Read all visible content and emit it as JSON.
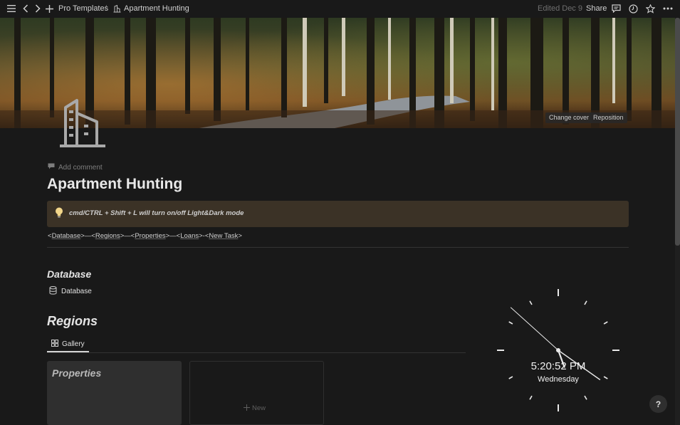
{
  "topbar": {
    "breadcrumb_parent": "Pro Templates",
    "breadcrumb_sep": "/",
    "breadcrumb_current": "Apartment Hunting",
    "edited": "Edited Dec 9",
    "share": "Share"
  },
  "cover": {
    "change_cover": "Change cover",
    "reposition": "Reposition"
  },
  "page": {
    "add_comment": "Add comment",
    "title": "Apartment Hunting",
    "callout_text": "cmd/CTRL + Shift + L will turn on/off Light&Dark mode",
    "nav": {
      "p1": "<",
      "database": "Database",
      "p2": ">—<",
      "regions": "Regions",
      "p3": ">—<",
      "properties": "Properties",
      "p4": ">—<",
      "loans": "Loans",
      "p5": ">-<",
      "new_task": "New Task",
      "p6": ">"
    },
    "database_heading": "Database",
    "database_link": "Database",
    "regions_heading": "Regions",
    "gallery_tab": "Gallery",
    "card_title": "Properties",
    "new_label": "New"
  },
  "clock": {
    "time": "5:20:52 PM",
    "day": "Wednesday"
  },
  "help": "?",
  "colors": {
    "background": "#191919",
    "callout_bg": "#3b3226",
    "card_bg": "#2f2f2f"
  }
}
